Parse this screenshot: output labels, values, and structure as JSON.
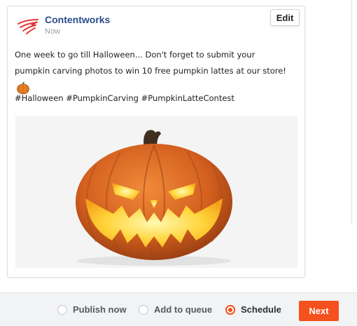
{
  "post": {
    "brand_name": "Contentworks",
    "timestamp": "Now",
    "edit_label": "Edit",
    "text": "One week to go till Halloween... Don't forget to submit your pumpkin carving photos to win 10 free pumpkin lattes at our store!",
    "emoji": "pumpkin-emoji",
    "hashtags": "#Halloween #PumpkinCarving #PumpkinLatteContest",
    "image": "jack-o-lantern-photo"
  },
  "footer": {
    "options": [
      {
        "label": "Publish now",
        "selected": false
      },
      {
        "label": "Add to queue",
        "selected": false
      },
      {
        "label": "Schedule",
        "selected": true
      }
    ],
    "next_label": "Next"
  },
  "colors": {
    "brand_text": "#2c4c8c",
    "accent": "#f4511e",
    "footer_bg": "#f2f3f5",
    "logo_red": "#e53935"
  }
}
